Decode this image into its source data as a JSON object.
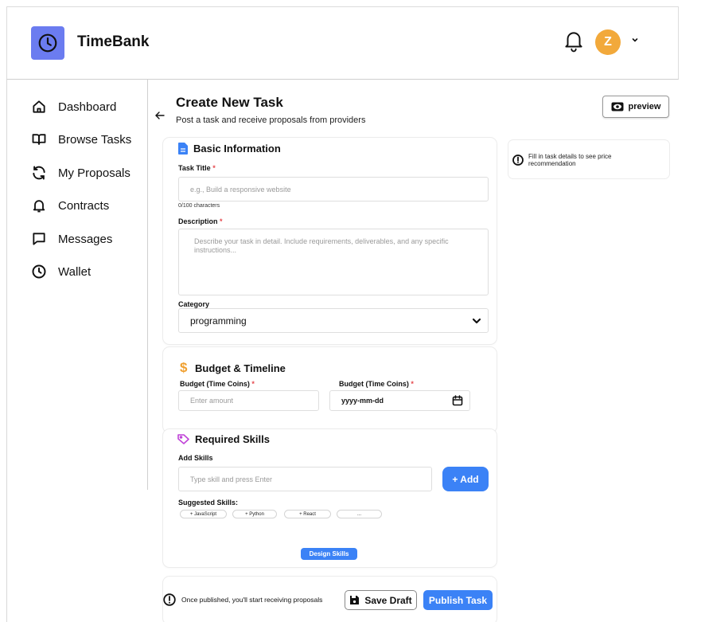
{
  "app": {
    "name": "TimeBank",
    "avatar_initial": "Z"
  },
  "colors": {
    "accent": "#3b82f6",
    "logo_bg": "#6b7cf0",
    "avatar_bg": "#f2a93b",
    "required": "#e5484d",
    "budget_icon": "#f0a030",
    "doc_icon": "#3b82f6",
    "tag_icon": "#c044d8"
  },
  "sidebar": {
    "items": [
      {
        "label": "Dashboard",
        "icon": "home-icon"
      },
      {
        "label": "Browse Tasks",
        "icon": "book-icon"
      },
      {
        "label": "My Proposals",
        "icon": "refresh-icon"
      },
      {
        "label": "Contracts",
        "icon": "bell-icon"
      },
      {
        "label": "Messages",
        "icon": "message-icon"
      },
      {
        "label": "Wallet",
        "icon": "clock-icon"
      }
    ]
  },
  "page": {
    "title": "Create New Task",
    "subtitle": "Post a task and receive proposals from providers",
    "preview_label": "preview"
  },
  "basic": {
    "title": "Basic Information",
    "task_title_label": "Task Title",
    "task_title_placeholder": "e.g., Build a responsive website",
    "char_count": "0/100 characters",
    "description_label": "Description",
    "description_placeholder": "Describe your task in detail. Include requirements, deliverables, and any specific instructions...",
    "category_label": "Category",
    "category_value": "programming"
  },
  "budget": {
    "title": "Budget & Timeline",
    "budget_label": "Budget (Time Coins)",
    "budget_placeholder": "Enter amount",
    "date_label": "Budget (Time Coins)",
    "date_placeholder": "yyyy-mm-dd"
  },
  "skills": {
    "title": "Required Skills",
    "add_label": "Add Skills",
    "add_placeholder": "Type skill and press Enter",
    "add_button": "+ Add",
    "suggested_label": "Suggested Skills:",
    "suggested": [
      "+ JavaScript",
      "+ Python",
      "+ React",
      "..."
    ],
    "design_skills_button": "Design Skills"
  },
  "price": {
    "text": "Fill in task details to see price recommendation"
  },
  "footer": {
    "note": "Once published, you'll start receiving proposals",
    "save_draft": "Save Draft",
    "publish": "Publish Task"
  }
}
